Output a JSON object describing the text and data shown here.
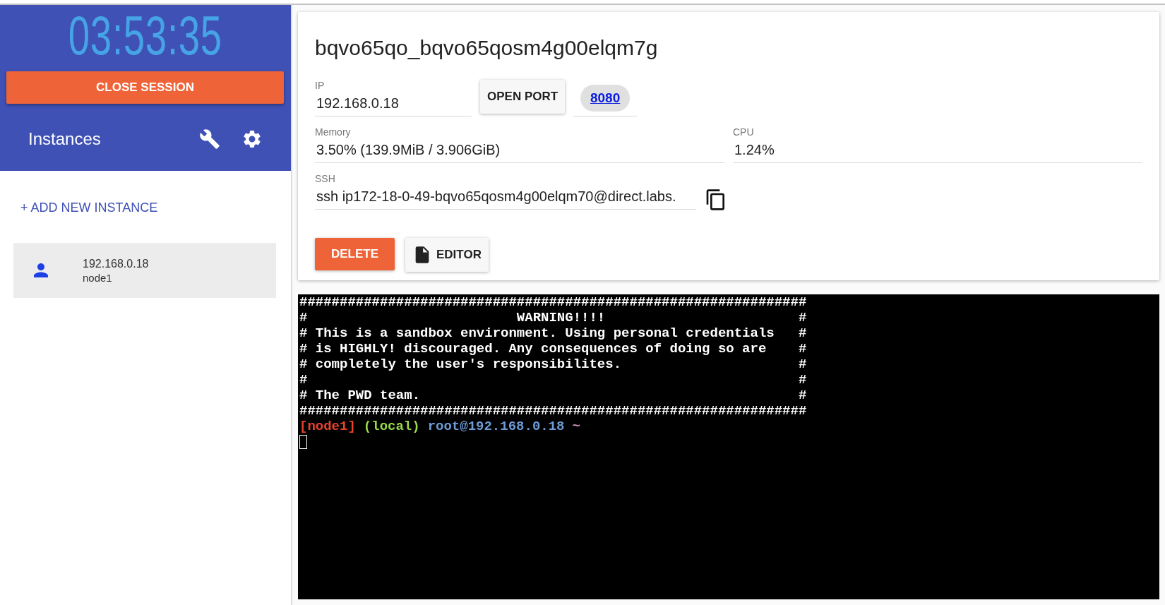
{
  "sidebar": {
    "timer": "03:53:35",
    "close_session_button": "CLOSE SESSION",
    "title": "Instances",
    "add_instance_link": "+ ADD NEW INSTANCE",
    "instances": [
      {
        "ip": "192.168.0.18",
        "name": "node1",
        "selected": true
      }
    ]
  },
  "instance_panel": {
    "title": "bqvo65qo_bqvo65qosm4g00elqm7g",
    "ip": {
      "label": "IP",
      "value": "192.168.0.18"
    },
    "open_port_button": "OPEN PORT",
    "ports": [
      "8080"
    ],
    "memory": {
      "label": "Memory",
      "value": "3.50% (139.9MiB / 3.906GiB)"
    },
    "cpu": {
      "label": "CPU",
      "value": "1.24%"
    },
    "ssh": {
      "label": "SSH",
      "value": "ssh ip172-18-0-49-bqvo65qosm4g00elqm70@direct.labs."
    },
    "delete_button": "DELETE",
    "editor_button": "EDITOR"
  },
  "terminal": {
    "lines": [
      "###############################################################",
      "#                          WARNING!!!!                        #",
      "# This is a sandbox environment. Using personal credentials   #",
      "# is HIGHLY! discouraged. Any consequences of doing so are    #",
      "# completely the user's responsibilites.                      #",
      "#                                                             #",
      "# The PWD team.                                               #",
      "###############################################################"
    ],
    "prompt": [
      {
        "text": "[node1]",
        "color": "#e8412e"
      },
      {
        "text": "(local)",
        "color": "#9ad94a"
      },
      {
        "text": "root@192.168.0.18",
        "color": "#6c9bd6"
      },
      {
        "text": "~",
        "color": "#c78bb0"
      }
    ]
  }
}
